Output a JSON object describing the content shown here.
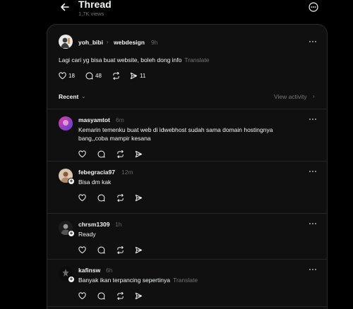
{
  "header": {
    "title": "Thread",
    "views": "1,7K views"
  },
  "main_post": {
    "username": "yoh_bibi",
    "topic": "webdesign",
    "time": "9h",
    "text": "Lagi cari yg bisa buat website, boleh dong info",
    "translate": "Translate",
    "likes": "18",
    "comments": "48",
    "shares": "11"
  },
  "sort": {
    "label": "Recent",
    "view_activity": "View activity"
  },
  "replies": [
    {
      "username": "masyamtot",
      "time": "6m",
      "text_line1": "Kemarin temenku buat web di idwebhost sudah sama domain hostingnya",
      "text_line2": "bang,,coba mampir kesana"
    },
    {
      "username": "febegracia97",
      "time": "12m",
      "text_line1": "Bisa dm kak"
    },
    {
      "username": "chrsm1309",
      "time": "1h",
      "text_line1": "Ready"
    },
    {
      "username": "kafinsw",
      "time": "6h",
      "text_line1": "Banyak ikan terpancing sepertinya",
      "translate": "Translate"
    }
  ],
  "colors": {
    "background": "#000000",
    "panel": "#101010",
    "text": "#f3f5f7",
    "muted": "#777777",
    "border": "#2a2a2a"
  }
}
